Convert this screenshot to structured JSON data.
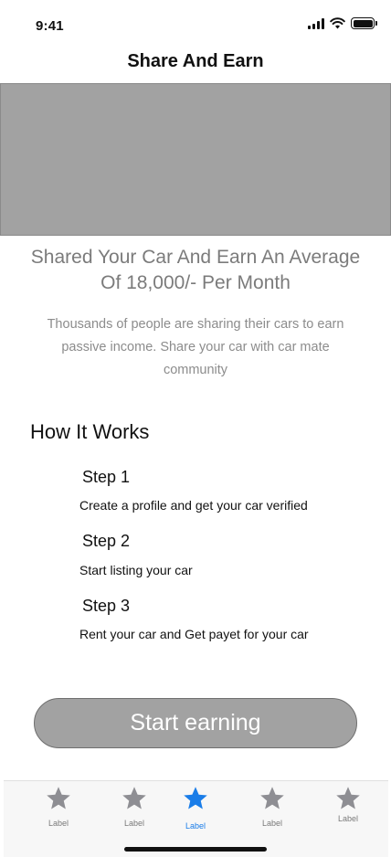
{
  "status_bar": {
    "time": "9:41"
  },
  "header": {
    "title": "Share And Earn"
  },
  "hero": {
    "headline": "Shared Your Car And Earn An Average Of 18,000/- Per Month",
    "subtext": "Thousands of people are sharing their cars to earn passive income. Share your car with car mate community"
  },
  "how_it_works": {
    "title": "How It Works",
    "steps": [
      {
        "title": "Step 1",
        "description": "Create a profile and get your car verified"
      },
      {
        "title": "Step 2",
        "description": "Start listing your car"
      },
      {
        "title": "Step 3",
        "description": "Rent your car and Get payet for your car"
      }
    ]
  },
  "cta": {
    "label": "Start earning"
  },
  "tab_bar": {
    "items": [
      {
        "label": "Label",
        "icon": "star-icon",
        "active": false
      },
      {
        "label": "Label",
        "icon": "star-icon",
        "active": false
      },
      {
        "label": "Label",
        "icon": "star-icon",
        "active": true
      },
      {
        "label": "Label",
        "icon": "star-icon",
        "active": false
      },
      {
        "label": "Label",
        "icon": "star-icon",
        "active": false
      }
    ]
  },
  "colors": {
    "placeholder_gray": "#a2a2a2",
    "active_tab": "#1a7de8",
    "inactive_tab": "#8e8e93",
    "muted_text": "#7b7b7b"
  }
}
